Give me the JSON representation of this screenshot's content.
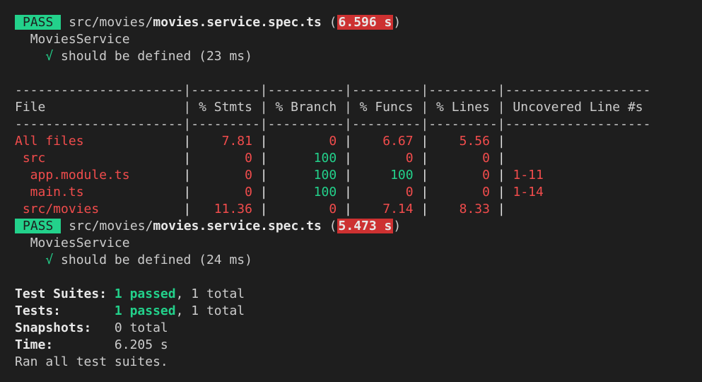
{
  "runs": [
    {
      "badge": "PASS",
      "path_dir": "src/movies/",
      "path_file": "movies.service.spec.ts",
      "duration": "6.596 s",
      "suite": "MoviesService",
      "check": "√",
      "test": "should be defined (23 ms)"
    },
    {
      "badge": "PASS",
      "path_dir": "src/movies/",
      "path_file": "movies.service.spec.ts",
      "duration": "5.473 s",
      "suite": "MoviesService",
      "check": "√",
      "test": "should be defined (24 ms)"
    }
  ],
  "coverage": {
    "separator": "----------------------|---------|----------|---------|---------|-------------------",
    "header": "File                  | % Stmts | % Branch | % Funcs | % Lines | Uncovered Line #s",
    "rows": [
      {
        "name": "All files",
        "stmts": "7.81",
        "branch": "0",
        "funcs": "6.67",
        "lines": "5.56",
        "uncovered": ""
      },
      {
        "name": " src",
        "stmts": "0",
        "branch": "100",
        "funcs": "0",
        "lines": "0",
        "uncovered": ""
      },
      {
        "name": "  app.module.ts",
        "stmts": "0",
        "branch": "100",
        "funcs": "100",
        "lines": "0",
        "uncovered": "1-11"
      },
      {
        "name": "  main.ts",
        "stmts": "0",
        "branch": "100",
        "funcs": "0",
        "lines": "0",
        "uncovered": "1-14"
      },
      {
        "name": " src/movies",
        "stmts": "11.36",
        "branch": "0",
        "funcs": "7.14",
        "lines": "8.33",
        "uncovered": ""
      }
    ]
  },
  "summary": {
    "suites_label": "Test Suites:",
    "suites_passed": "1 passed",
    "suites_rest": ", 1 total",
    "tests_label": "Tests:",
    "tests_passed": "1 passed",
    "tests_rest": ", 1 total",
    "snapshots_label": "Snapshots:",
    "snapshots_value": "0 total",
    "time_label": "Time:",
    "time_value": "6.205 s",
    "footer": "Ran all test suites."
  },
  "colors": {
    "background": "#1e1e1e",
    "foreground": "#cccccc",
    "red": "#f14c4c",
    "green": "#23d18b",
    "pass_badge": "#23d18b",
    "slow_badge": "#cd3131"
  }
}
